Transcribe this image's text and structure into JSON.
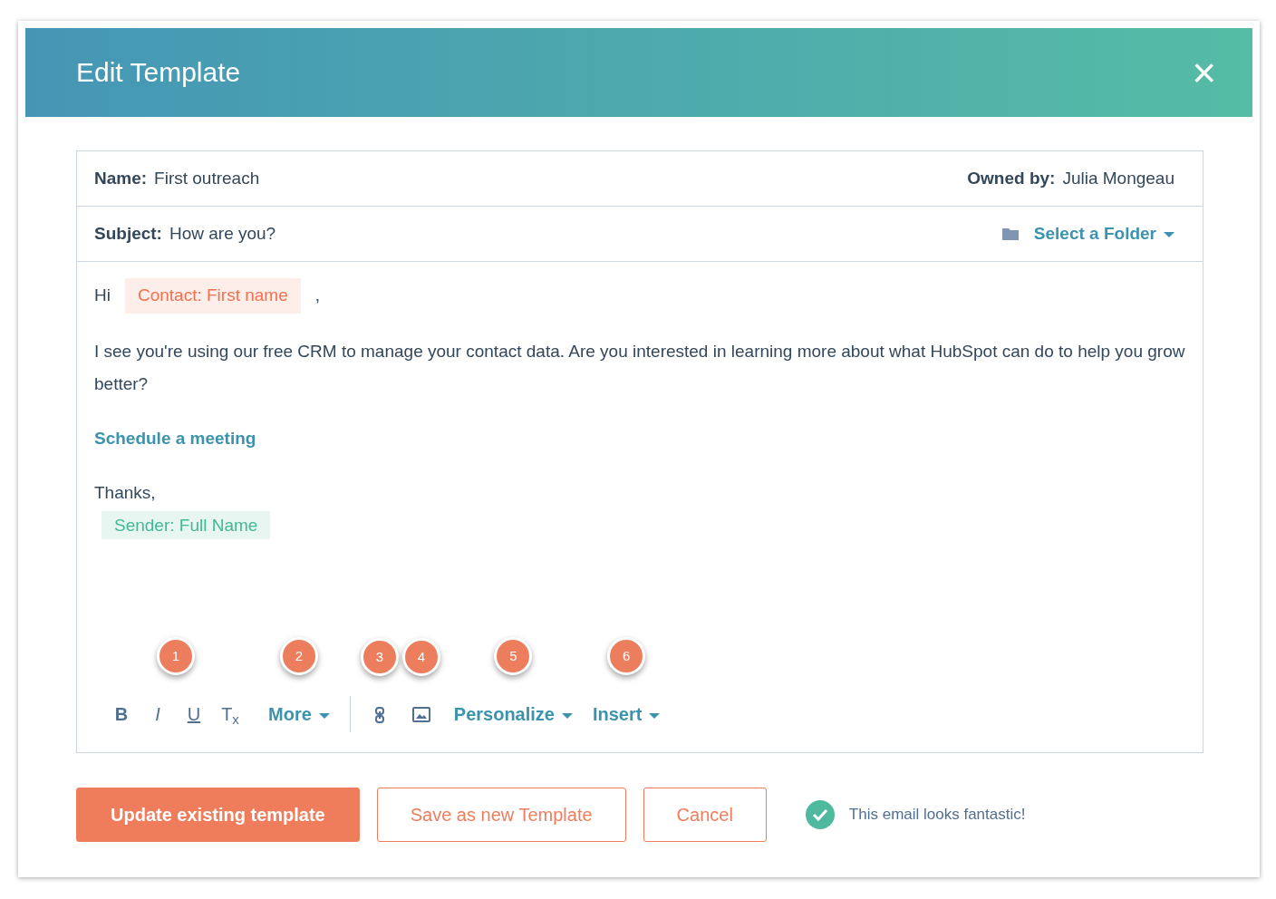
{
  "dialog": {
    "title": "Edit Template",
    "close": "×"
  },
  "fields": [
    {
      "label": "Name:",
      "value": "First outreach",
      "right_label": "Owned by:",
      "right_value": "Julia Mongeau"
    },
    {
      "label": "Subject:",
      "value": "How are you?",
      "folder": "Select a Folder"
    }
  ],
  "body": [
    {
      "kind": "greeting",
      "text": "Hi",
      "token": "Contact: First name",
      "color": "#f2704f",
      "after": ","
    },
    {
      "kind": "paragraph",
      "text": "I see you're using our free CRM to manage your contact data. Are you interested in learning more about what HubSpot can do to help you grow better?"
    },
    {
      "kind": "link",
      "text": "Schedule a meeting"
    },
    {
      "kind": "signoff",
      "text": "Thanks,",
      "token": "Sender: Full Name",
      "color": "#42b896"
    }
  ],
  "toolbar": [
    {
      "kind": "format",
      "callout": "1",
      "items": [
        "B",
        "I",
        "U",
        "T$_{x}$"
      ]
    },
    {
      "kind": "dropdown",
      "callout": "2",
      "label": "More"
    },
    {
      "kind": "divider"
    },
    {
      "kind": "link",
      "callout": "3"
    },
    {
      "kind": "image",
      "callout": "4"
    },
    {
      "kind": "dropdown",
      "callout": "5",
      "label": "Personalize"
    },
    {
      "kind": "dropdown",
      "callout": "6",
      "label": "Insert"
    }
  ],
  "buttons": [
    {
      "label": "Update existing template",
      "primary": true
    },
    {
      "label": "Save as new Template",
      "primary": false
    },
    {
      "label": "Cancel",
      "primary": false
    }
  ],
  "status": "This email looks fantastic!"
}
